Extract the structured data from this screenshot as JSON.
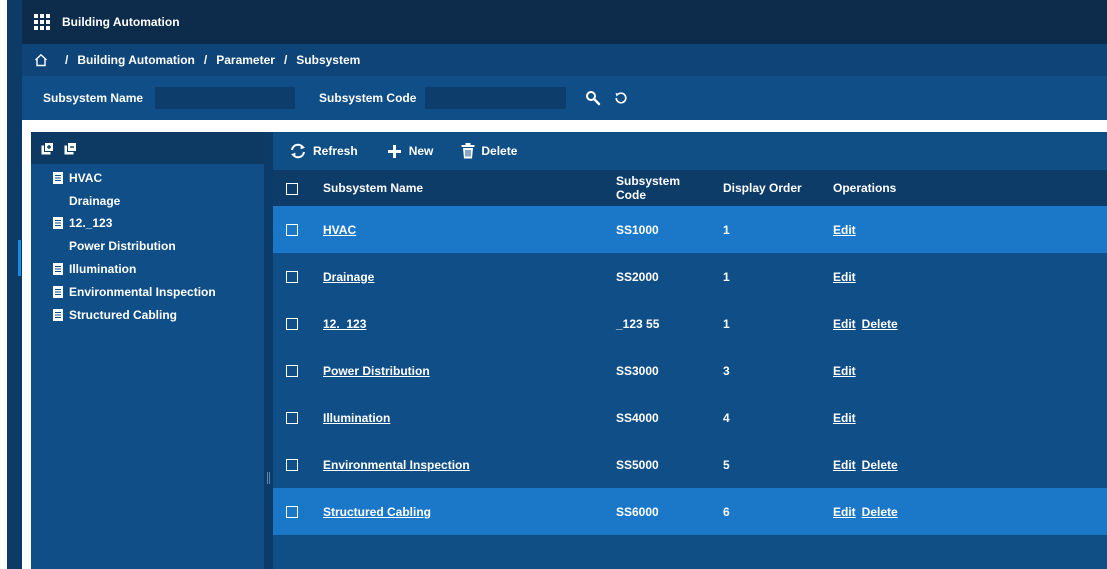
{
  "app": {
    "title": "Building Automation"
  },
  "breadcrumb": {
    "items": [
      "Building Automation",
      "Parameter",
      "Subsystem"
    ],
    "separator": "/"
  },
  "search": {
    "name_label": "Subsystem Name",
    "name_value": "",
    "code_label": "Subsystem Code",
    "code_value": ""
  },
  "tree": {
    "items": [
      {
        "label": "HVAC"
      },
      {
        "label": "Drainage"
      },
      {
        "label": "12._123"
      },
      {
        "label": "Power Distribution"
      },
      {
        "label": "Illumination"
      },
      {
        "label": "Environmental Inspection"
      },
      {
        "label": "Structured Cabling"
      }
    ]
  },
  "toolbar": {
    "refresh_label": "Refresh",
    "new_label": "New",
    "delete_label": "Delete"
  },
  "table": {
    "headers": {
      "name": "Subsystem Name",
      "code": "Subsystem Code",
      "order": "Display Order",
      "operations": "Operations"
    },
    "rows": [
      {
        "name": "HVAC",
        "code": "SS1000",
        "order": "1",
        "edit": "Edit",
        "delete": ""
      },
      {
        "name": "Drainage",
        "code": "SS2000",
        "order": "1",
        "edit": "Edit",
        "delete": ""
      },
      {
        "name": "12._123",
        "code": "_123 55",
        "order": "1",
        "edit": "Edit",
        "delete": "Delete"
      },
      {
        "name": "Power Distribution",
        "code": "SS3000",
        "order": "3",
        "edit": "Edit",
        "delete": ""
      },
      {
        "name": "Illumination",
        "code": "SS4000",
        "order": "4",
        "edit": "Edit",
        "delete": ""
      },
      {
        "name": "Environmental Inspection",
        "code": "SS5000",
        "order": "5",
        "edit": "Edit",
        "delete": "Delete"
      },
      {
        "name": "Structured Cabling",
        "code": "SS6000",
        "order": "6",
        "edit": "Edit",
        "delete": "Delete"
      }
    ]
  },
  "colors": {
    "topbar": "#0d2b4a",
    "breadcrumb": "#0e4478",
    "panel": "#0f4e87",
    "row_highlight": "#1b78c9",
    "header": "#0d3c69"
  }
}
